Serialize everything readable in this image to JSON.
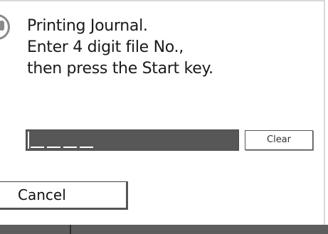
{
  "message": {
    "line1": "Printing Journal.",
    "line2": "Enter 4 digit file No.,",
    "line3": "then press the Start key."
  },
  "file_number": {
    "value": "",
    "digit_count": 4
  },
  "buttons": {
    "clear_label": "Clear",
    "cancel_label": "Cancel"
  },
  "icons": {
    "message_icon": "info-icon"
  }
}
